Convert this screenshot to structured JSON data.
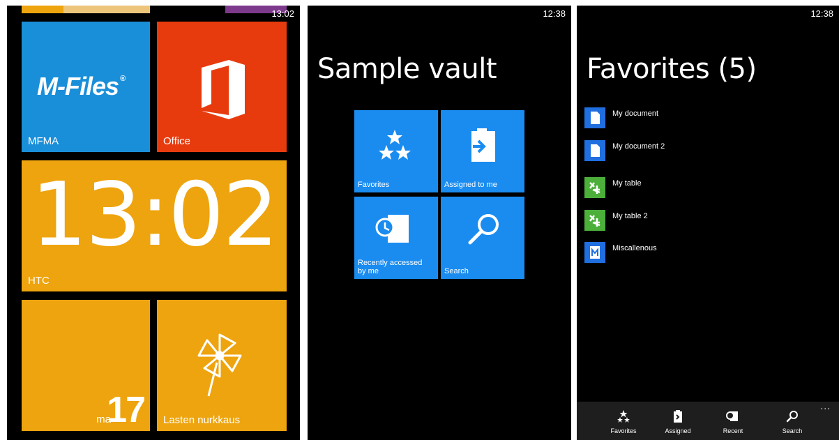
{
  "start_screen": {
    "clock": "13:02",
    "tiles": {
      "mfma": {
        "logo": "M-Files",
        "reg": "®",
        "label": "MFMA"
      },
      "office": {
        "label": "Office"
      },
      "htc": {
        "time": "13:02",
        "label": "HTC"
      },
      "calendar": {
        "day": "ma",
        "date": "17"
      },
      "kids": {
        "label": "Lasten nurkkaus"
      }
    }
  },
  "vault_screen": {
    "clock": "12:38",
    "title": "Sample vault",
    "tiles": [
      {
        "label": "Favorites",
        "icon": "stars-icon"
      },
      {
        "label": "Assigned to me",
        "icon": "clipboard-arrow-icon"
      },
      {
        "label": "Recently accessed\nby  me",
        "icon": "clock-document-icon"
      },
      {
        "label": "Search",
        "icon": "search-icon"
      }
    ]
  },
  "favorites_screen": {
    "clock": "12:38",
    "title": "Favorites (5)",
    "items": [
      {
        "label": "My document",
        "icon": "document-icon"
      },
      {
        "label": "My document 2",
        "icon": "document-icon"
      },
      {
        "label": "My table",
        "icon": "table-icon"
      },
      {
        "label": "My table 2",
        "icon": "table-icon"
      },
      {
        "label": "Miscallenous",
        "icon": "misc-document-icon"
      }
    ],
    "appbar": {
      "more": "...",
      "buttons": [
        {
          "label": "Favorites",
          "icon": "stars-icon"
        },
        {
          "label": "Assigned",
          "icon": "clipboard-icon"
        },
        {
          "label": "Recent",
          "icon": "recent-icon"
        },
        {
          "label": "Search",
          "icon": "search-icon"
        }
      ]
    }
  },
  "colors": {
    "mfiles_blue": "#1a8fd9",
    "office_red": "#e73b0e",
    "tile_orange": "#eea40e",
    "vault_blue": "#1a8cf0",
    "doc_blue": "#1f6fe0",
    "table_green": "#4caf3a"
  }
}
